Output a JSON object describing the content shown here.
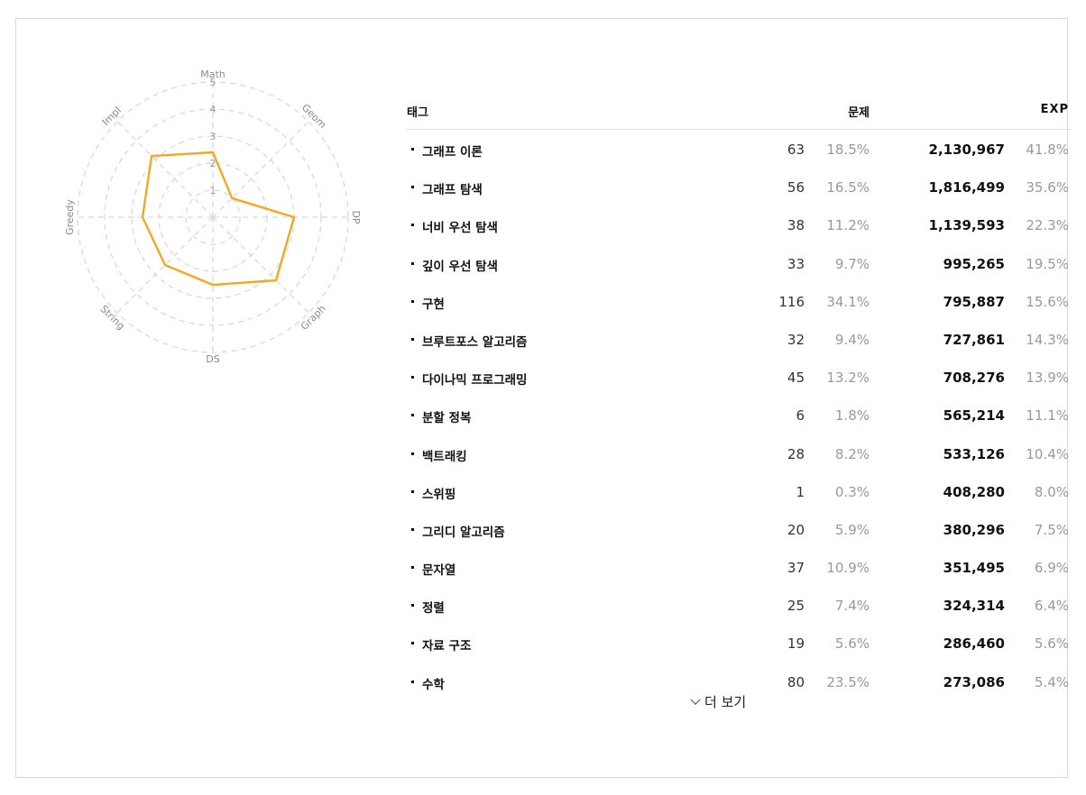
{
  "radar": {
    "axes": [
      "Math",
      "Geom",
      "DP",
      "Graph",
      "DS",
      "String",
      "Greedy",
      "Impl"
    ],
    "ticks": [
      "1",
      "2",
      "3",
      "4",
      "5"
    ],
    "max": 5,
    "values": [
      2.4,
      1.0,
      3.0,
      3.3,
      2.5,
      2.5,
      2.6,
      3.2
    ],
    "line_color": "#f5a623",
    "grid_color": "#d6d6d6"
  },
  "chart_data": {
    "type": "radar",
    "categories": [
      "Math",
      "Geom",
      "DP",
      "Graph",
      "DS",
      "String",
      "Greedy",
      "Impl"
    ],
    "values": [
      2.4,
      1.0,
      3.0,
      3.3,
      2.5,
      2.5,
      2.6,
      3.2
    ],
    "rlim": [
      0,
      5
    ],
    "ticks": [
      1,
      2,
      3,
      4,
      5
    ],
    "grid": true
  },
  "table": {
    "headers": {
      "tag": "태그",
      "count": "문제",
      "exp": "EXP"
    },
    "rows": [
      {
        "tag": "그래프 이론",
        "count": "63",
        "count_pct": "18.5%",
        "exp": "2,130,967",
        "exp_pct": "41.8%"
      },
      {
        "tag": "그래프 탐색",
        "count": "56",
        "count_pct": "16.5%",
        "exp": "1,816,499",
        "exp_pct": "35.6%"
      },
      {
        "tag": "너비 우선 탐색",
        "count": "38",
        "count_pct": "11.2%",
        "exp": "1,139,593",
        "exp_pct": "22.3%"
      },
      {
        "tag": "깊이 우선 탐색",
        "count": "33",
        "count_pct": "9.7%",
        "exp": "995,265",
        "exp_pct": "19.5%"
      },
      {
        "tag": "구현",
        "count": "116",
        "count_pct": "34.1%",
        "exp": "795,887",
        "exp_pct": "15.6%"
      },
      {
        "tag": "브루트포스 알고리즘",
        "count": "32",
        "count_pct": "9.4%",
        "exp": "727,861",
        "exp_pct": "14.3%"
      },
      {
        "tag": "다이나믹 프로그래밍",
        "count": "45",
        "count_pct": "13.2%",
        "exp": "708,276",
        "exp_pct": "13.9%"
      },
      {
        "tag": "분할 정복",
        "count": "6",
        "count_pct": "1.8%",
        "exp": "565,214",
        "exp_pct": "11.1%"
      },
      {
        "tag": "백트래킹",
        "count": "28",
        "count_pct": "8.2%",
        "exp": "533,126",
        "exp_pct": "10.4%"
      },
      {
        "tag": "스위핑",
        "count": "1",
        "count_pct": "0.3%",
        "exp": "408,280",
        "exp_pct": "8.0%"
      },
      {
        "tag": "그리디 알고리즘",
        "count": "20",
        "count_pct": "5.9%",
        "exp": "380,296",
        "exp_pct": "7.5%"
      },
      {
        "tag": "문자열",
        "count": "37",
        "count_pct": "10.9%",
        "exp": "351,495",
        "exp_pct": "6.9%"
      },
      {
        "tag": "정렬",
        "count": "25",
        "count_pct": "7.4%",
        "exp": "324,314",
        "exp_pct": "6.4%"
      },
      {
        "tag": "자료 구조",
        "count": "19",
        "count_pct": "5.6%",
        "exp": "286,460",
        "exp_pct": "5.6%"
      },
      {
        "tag": "수학",
        "count": "80",
        "count_pct": "23.5%",
        "exp": "273,086",
        "exp_pct": "5.4%"
      }
    ]
  },
  "more_button": {
    "label": "더 보기",
    "icon": "chevron-down-icon"
  }
}
